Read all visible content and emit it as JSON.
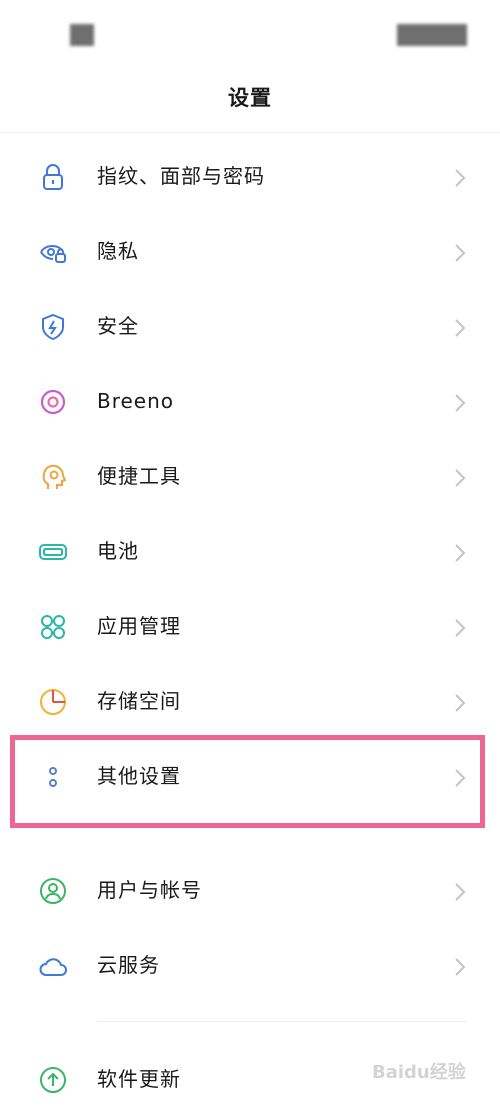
{
  "header": {
    "title": "设置"
  },
  "settings": [
    {
      "label": "指纹、面部与密码",
      "icon": "lock-icon",
      "color": "#3f78d8"
    },
    {
      "label": "隐私",
      "icon": "privacy-eye-lock-icon",
      "color": "#3f78d8"
    },
    {
      "label": "安全",
      "icon": "shield-bolt-icon",
      "color": "#3f78d8"
    },
    {
      "label": "Breeno",
      "icon": "breeno-ring-icon",
      "color": "#c95ad6"
    },
    {
      "label": "便捷工具",
      "icon": "head-gear-icon",
      "color": "#f2a33a"
    },
    {
      "label": "电池",
      "icon": "battery-icon",
      "color": "#2bb7a5"
    },
    {
      "label": "应用管理",
      "icon": "app-grid-icon",
      "color": "#2bb7a5"
    },
    {
      "label": "存储空间",
      "icon": "storage-pie-icon",
      "color": "#f2b233"
    },
    {
      "label": "其他设置",
      "icon": "more-dots-icon",
      "color": "#5b7fc7"
    },
    {
      "label": "用户与帐号",
      "icon": "user-icon",
      "color": "#3ab565"
    },
    {
      "label": "云服务",
      "icon": "cloud-icon",
      "color": "#3f78d8"
    },
    {
      "label": "软件更新",
      "icon": "update-arrow-icon",
      "color": "#3ab565"
    }
  ],
  "watermark": "Baidu经验"
}
